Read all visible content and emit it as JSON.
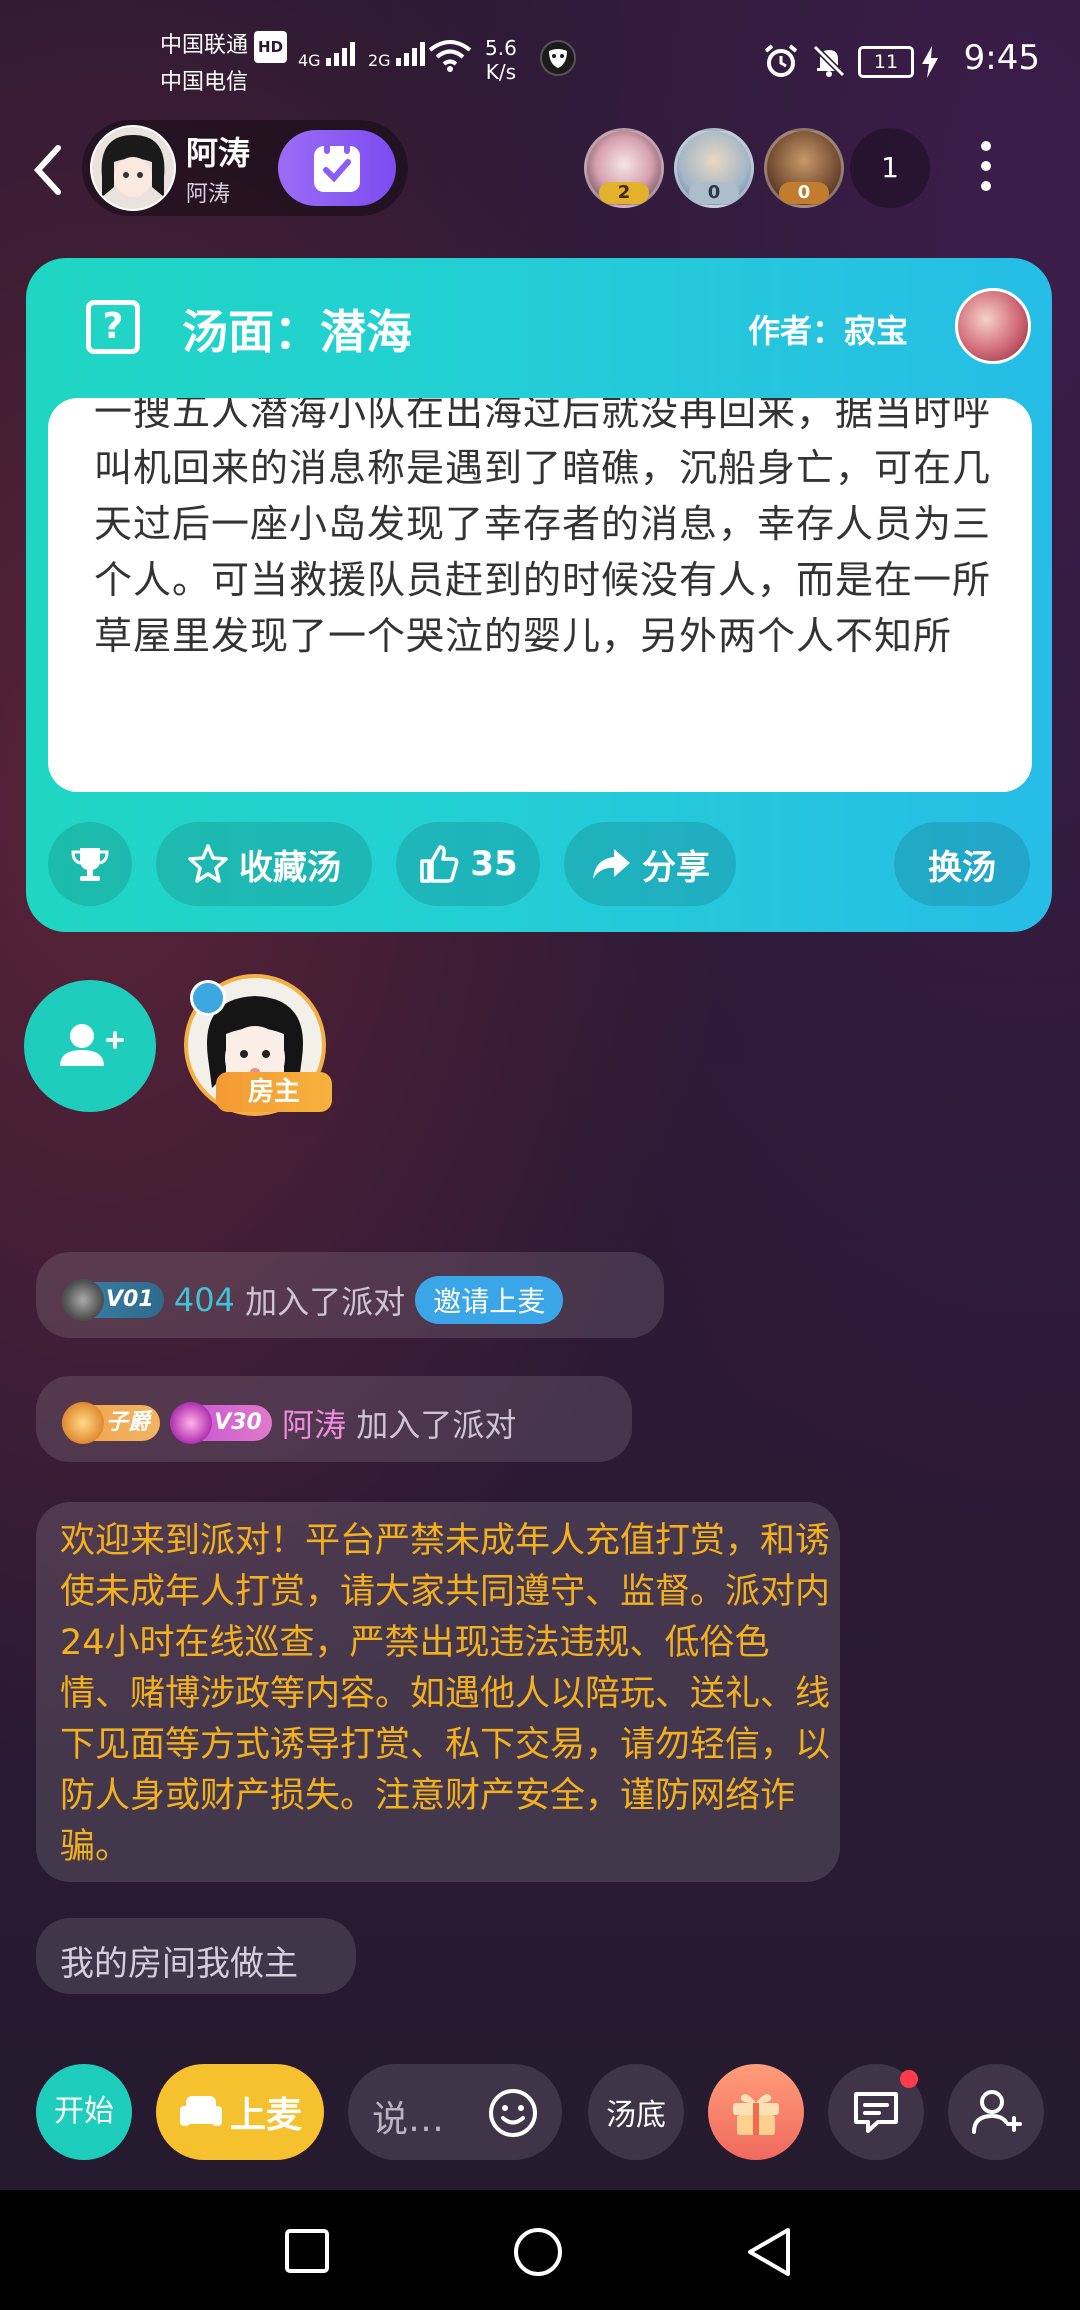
{
  "status_bar": {
    "carrier1": "中国联通",
    "carrier1_tag": "HD",
    "net1": "4G",
    "net2": "2G",
    "carrier2": "中国电信",
    "speed_value": "5.6",
    "speed_unit": "K/s",
    "battery": "11",
    "time": "9:45"
  },
  "header": {
    "owner_name": "阿涛",
    "owner_sub": "阿涛",
    "rank_badges": [
      "2",
      "0",
      "0"
    ],
    "audience_count": "1"
  },
  "card": {
    "title": "汤面：潜海",
    "author_label": "作者：寂宝",
    "story": "一搜五人潜海小队在出海过后就没再回来，据当时呼叫机回来的消息称是遇到了暗礁，沉船身亡，可在几天过后一座小岛发现了幸存者的消息，幸存人员为三个人。可当救援队员赶到的时候没有人，而是在一所草屋里发现了一个哭泣的婴儿，另外两个人不知所",
    "favorite_label": "收藏汤",
    "like_count": "35",
    "share_label": "分享",
    "change_label": "换汤"
  },
  "seats": {
    "host_tag": "房主"
  },
  "chat": {
    "msg1_level": "V01",
    "msg1_user": "404",
    "msg1_text": "加入了派对",
    "msg1_invite": "邀请上麦",
    "msg2_title": "子爵",
    "msg2_level": "V30",
    "msg2_user": "阿涛",
    "msg2_text": "加入了派对",
    "notice": "欢迎来到派对！平台严禁未成年人充值打赏，和诱使未成年人打赏，请大家共同遵守、监督。派对内24小时在线巡查，严禁出现违法违规、低俗色情、赌博涉政等内容。如遇他人以陪玩、送礼、线下见面等方式诱导打赏、私下交易，请勿轻信，以防人身或财产损失。注意财产安全，谨防网络诈骗。",
    "room_msg": "我的房间我做主"
  },
  "bottom_bar": {
    "start_label": "开始",
    "mic_label": "上麦",
    "input_placeholder": "说…",
    "answer_label": "汤底"
  },
  "colors": {
    "card_gradient_start": "#1fd6c2",
    "card_gradient_end": "#27bde6",
    "notice_text": "#f2b01e",
    "mic_button": "#f5c12e",
    "username_pink": "#f08be0",
    "username_teal": "#3fc3d6"
  }
}
